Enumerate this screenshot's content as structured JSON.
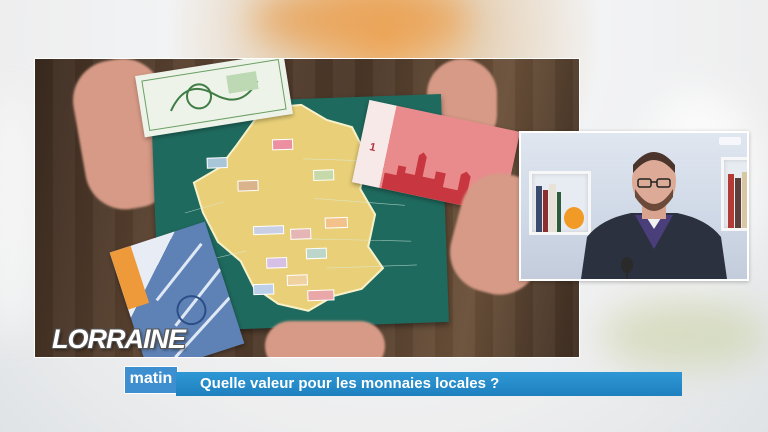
{
  "branding": {
    "show_title": "LORRAINE",
    "show_subtitle": "matin"
  },
  "headline": {
    "text": "Quelle valeur pour les monnaies locales ?"
  },
  "colors": {
    "headline_bar": "#1e80bf",
    "brand_box": "#3d8fcf",
    "map_board": "#1f6a5e",
    "map_land": "#e9d078"
  },
  "main_photo": {
    "banknote_denomination": "1"
  }
}
